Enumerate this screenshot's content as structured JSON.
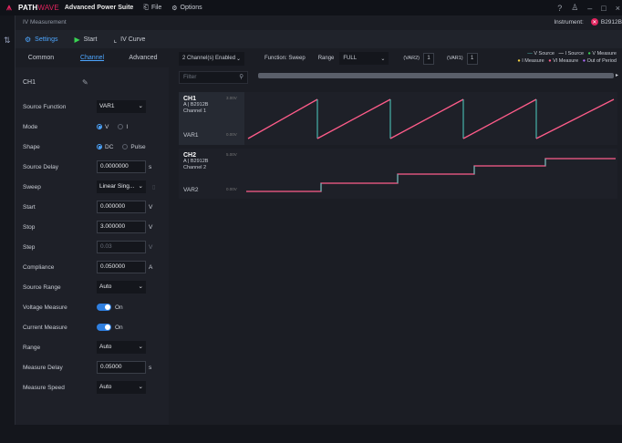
{
  "app": {
    "brand_main": "PATH",
    "brand_wave": "WAVE",
    "suite": "Advanced Power Suite",
    "menu_file": "File",
    "menu_options": "Options",
    "subtitle": "IV Measurement",
    "instrument_label": "Instrument:",
    "instrument_name": "B2912B"
  },
  "toolbar": {
    "settings": "Settings",
    "start": "Start",
    "ivcurve": "IV Curve"
  },
  "tabs": [
    "Common",
    "Channel",
    "Advanced"
  ],
  "channel_panel": {
    "title": "CH1",
    "source_function_label": "Source Function",
    "source_function_value": "VAR1",
    "mode_label": "Mode",
    "mode_v": "V",
    "mode_i": "I",
    "shape_label": "Shape",
    "shape_dc": "DC",
    "shape_pulse": "Pulse",
    "source_delay_label": "Source Delay",
    "source_delay_value": "0.0000000",
    "source_delay_unit": "s",
    "sweep_label": "Sweep",
    "sweep_value": "Linear Sing...",
    "start_label": "Start",
    "start_value": "0.000000",
    "start_unit": "V",
    "stop_label": "Stop",
    "stop_value": "3.000000",
    "stop_unit": "V",
    "step_label": "Step",
    "step_value": "0.03",
    "step_unit": "V",
    "compliance_label": "Compliance",
    "compliance_value": "0.050000",
    "compliance_unit": "A",
    "source_range_label": "Source Range",
    "source_range_value": "Auto",
    "voltage_measure_label": "Voltage Measure",
    "voltage_measure_value": "On",
    "current_measure_label": "Current Measure",
    "current_measure_value": "On",
    "range_label": "Range",
    "range_value": "Auto",
    "measure_delay_label": "Measure Delay",
    "measure_delay_value": "0.05000",
    "measure_delay_unit": "s",
    "measure_speed_label": "Measure Speed",
    "measure_speed_value": "Auto"
  },
  "right": {
    "channels_enabled": "2 Channel(s) Enabled",
    "function_label": "Function: Sweep",
    "range_label": "Range",
    "range_value": "FULL",
    "var2_label": "(VAR2)",
    "var2_value": "1",
    "var1_label": "(VAR1)",
    "var1_value": "1",
    "filter_placeholder": "Filter",
    "legend": {
      "v_source": "V Source",
      "i_source": "I Source",
      "v_measure": "V Measure",
      "i_measure": "I Measure",
      "vi_measure": "VI Measure",
      "out_of_period": "Out of Period"
    },
    "ch1": {
      "name": "CH1",
      "model": "A | B2912B",
      "channel": "Channel 1",
      "var": "VAR1",
      "tick_top": "3.00V",
      "tick_bottom": "0.00V"
    },
    "ch2": {
      "name": "CH2",
      "model": "A | B2912B",
      "channel": "Channel 2",
      "var": "VAR2",
      "tick_top": "5.00V",
      "tick_bottom": "0.00V"
    }
  },
  "colors": {
    "accent": "#4da6ff",
    "brand": "#e0245e",
    "v_source": "#4fd1c5",
    "i_source": "#ffffff",
    "v_measure": "#39d353",
    "i_measure": "#f5d142",
    "vi_measure": "#ff5c8a",
    "out_of_period": "#b06cff"
  }
}
